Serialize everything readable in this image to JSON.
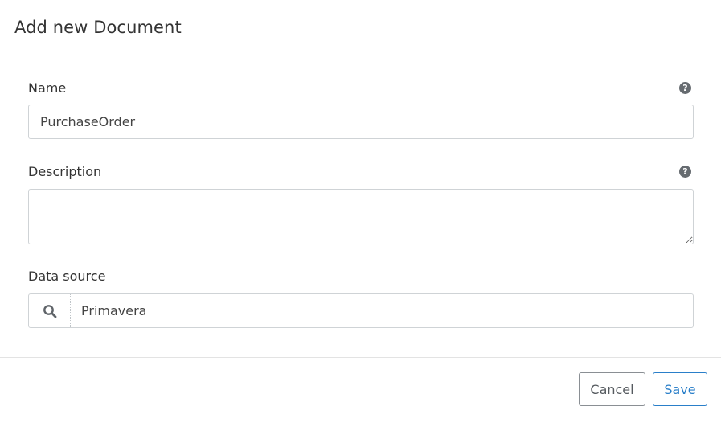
{
  "dialog": {
    "title": "Add new Document"
  },
  "form": {
    "name": {
      "label": "Name",
      "value": "PurchaseOrder",
      "help_icon": "question-circle-icon"
    },
    "description": {
      "label": "Description",
      "value": "",
      "help_icon": "question-circle-icon"
    },
    "data_source": {
      "label": "Data source",
      "value": "Primavera",
      "icon": "search-icon"
    }
  },
  "footer": {
    "cancel_label": "Cancel",
    "save_label": "Save"
  },
  "colors": {
    "primary": "#2a7fc9",
    "border": "#cfd3d6",
    "text": "#333333",
    "help_icon_bg": "#666b70"
  }
}
